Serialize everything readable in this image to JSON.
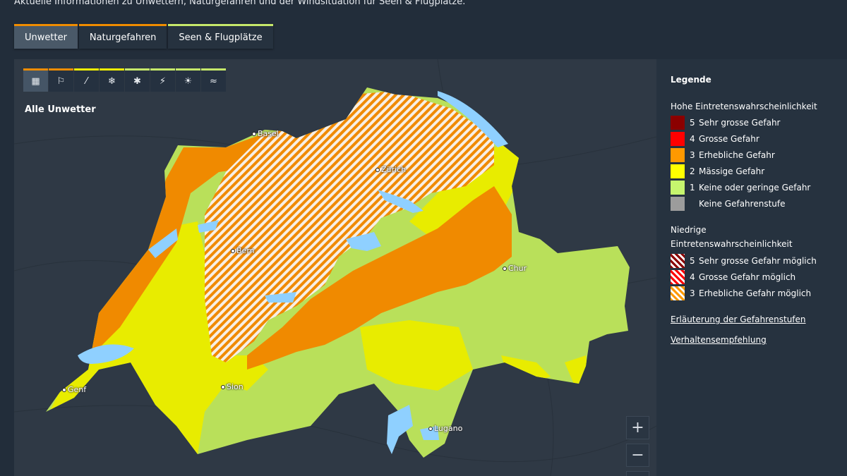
{
  "intro_text": "Aktuelle Informationen zu Unwettern, Naturgefahren und der Windsituation für Seen & Flugplätze.",
  "tabs": [
    {
      "label": "Unwetter",
      "active": true
    },
    {
      "label": "Naturgefahren",
      "active": false
    },
    {
      "label": "Seen & Flugplätze",
      "active": false
    }
  ],
  "filters": {
    "all": "▦",
    "wind": "⚐",
    "rain": "⁄",
    "snow": "❄",
    "frost": "✱",
    "thunder": "⚡",
    "heat": "☀",
    "slippery": "≈"
  },
  "map": {
    "title": "Alle Unwetter",
    "cities": [
      {
        "name": "Basel"
      },
      {
        "name": "Zürich"
      },
      {
        "name": "Bern"
      },
      {
        "name": "Chur"
      },
      {
        "name": "Genf"
      },
      {
        "name": "Sion"
      },
      {
        "name": "Lugano"
      }
    ],
    "zoom_in": "+",
    "zoom_out": "−"
  },
  "legend": {
    "title": "Legende",
    "high_title": "Hohe Eintretenswahrscheinlichkeit",
    "high": [
      {
        "num": "5",
        "label": "Sehr grosse Gefahr",
        "color": "#8b0000"
      },
      {
        "num": "4",
        "label": "Grosse Gefahr",
        "color": "#ff0000"
      },
      {
        "num": "3",
        "label": "Erhebliche Gefahr",
        "color": "#ff9900"
      },
      {
        "num": "2",
        "label": "Mässige Gefahr",
        "color": "#ffff00"
      },
      {
        "num": "1",
        "label": "Keine oder geringe Gefahr",
        "color": "#c6f56e"
      },
      {
        "num": "",
        "label": "Keine Gefahrenstufe",
        "color": "#9c9c9c"
      }
    ],
    "low_title_line1": "Niedrige",
    "low_title_line2": "Eintretenswahrscheinlichkeit",
    "low": [
      {
        "num": "5",
        "label": "Sehr grosse Gefahr möglich",
        "color": "#8b0000"
      },
      {
        "num": "4",
        "label": "Grosse Gefahr möglich",
        "color": "#ff0000"
      },
      {
        "num": "3",
        "label": "Erhebliche Gefahr möglich",
        "color": "#ff9900"
      }
    ],
    "link1": "Erläuterung der Gefahrenstufen",
    "link2": "Verhaltensempfehlung"
  },
  "colors": {
    "danger3": "#f08a00",
    "danger2": "#e8ec00",
    "danger1": "#b9e05a",
    "lake": "#8fd0ff",
    "background": "#222d3a"
  }
}
